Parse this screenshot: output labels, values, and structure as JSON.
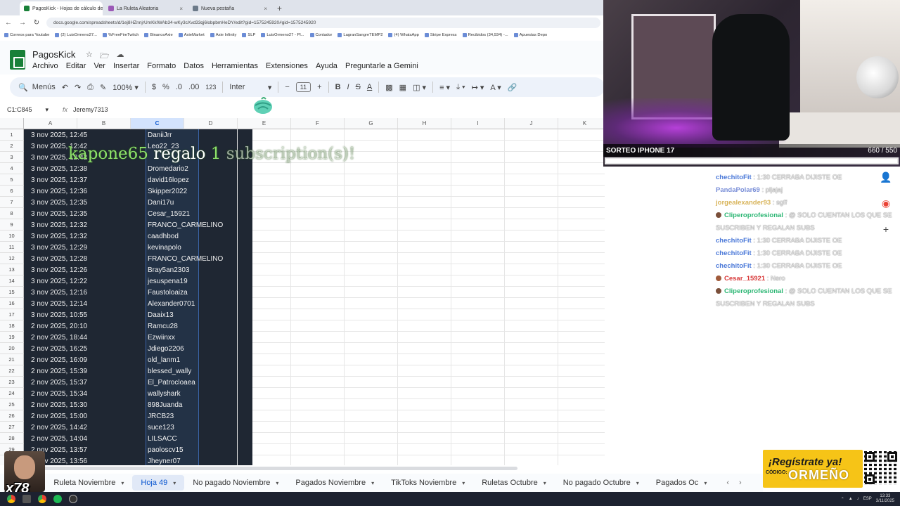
{
  "browser": {
    "tabs": [
      {
        "label": "PagosKick - Hojas de cálculo de",
        "active": true,
        "color": "#188038"
      },
      {
        "label": "La Ruleta Aleatoria",
        "active": false,
        "color": "#9b59b6"
      },
      {
        "label": "Nueva pestaña",
        "active": false,
        "color": "#6c7a89"
      }
    ],
    "new_tab": "+",
    "url": "docs.google.com/spreadsheets/d/1ej8HZnnjrUmKkIWAb34-wKy3cXvd33qj6lobpbmHeDY/edit?gid=1575245920#gid=1575245920",
    "bookmarks": [
      "Correos para Youtube",
      "(2) LuisOrmeno27...",
      "%FreeFireTwitch",
      "BinanceAxie",
      "AxieMarket",
      "Axie Infinity",
      "SLP",
      "LuisOrmeno27 - Pl...",
      "Contador",
      "LagranSangreTEMP2",
      "(4) WhatsApp",
      "Stripe Express",
      "Recibidos (34,934) -...",
      "Apuestas Depo"
    ]
  },
  "sheets": {
    "title": "PagosKick",
    "menu": [
      "Archivo",
      "Editar",
      "Ver",
      "Insertar",
      "Formato",
      "Datos",
      "Herramientas",
      "Extensiones",
      "Ayuda",
      "Preguntarle a Gemini"
    ],
    "toolbar": {
      "search": "Menús",
      "zoom": "100%",
      "currency": "$",
      "percent": "%",
      "dec_less": ".0",
      "dec_more": ".00",
      "num_format": "123",
      "font": "Inter",
      "font_size": "11",
      "bold": "B",
      "italic": "I",
      "strike": "S",
      "text_color": "A"
    },
    "name_box": "C1:C845",
    "formula_value": "Jeremy7313",
    "columns": [
      "A",
      "B",
      "C",
      "D",
      "E",
      "F",
      "G",
      "H",
      "I",
      "J",
      "K"
    ],
    "rows": [
      {
        "n": "1",
        "a": "3 nov 2025, 12:45",
        "c": "DaniiJrr"
      },
      {
        "n": "2",
        "a": "3 nov 2025, 12:42",
        "c": "Leo22_23"
      },
      {
        "n": "3",
        "a": "3 nov 2025, 12:42",
        "c": ""
      },
      {
        "n": "4",
        "a": "3 nov 2025, 12:38",
        "c": "Dromedario2"
      },
      {
        "n": "5",
        "a": "3 nov 2025, 12:37",
        "c": "david16lopez"
      },
      {
        "n": "6",
        "a": "3 nov 2025, 12:36",
        "c": "Skipper2022"
      },
      {
        "n": "7",
        "a": "3 nov 2025, 12:35",
        "c": "Dani17u"
      },
      {
        "n": "8",
        "a": "3 nov 2025, 12:35",
        "c": "Cesar_15921"
      },
      {
        "n": "9",
        "a": "3 nov 2025, 12:32",
        "c": "FRANCO_CARMELINO"
      },
      {
        "n": "10",
        "a": "3 nov 2025, 12:32",
        "c": "caadhbod"
      },
      {
        "n": "11",
        "a": "3 nov 2025, 12:29",
        "c": "kevinapolo"
      },
      {
        "n": "12",
        "a": "3 nov 2025, 12:28",
        "c": "FRANCO_CARMELINO"
      },
      {
        "n": "13",
        "a": "3 nov 2025, 12:26",
        "c": "Bray5an2303"
      },
      {
        "n": "14",
        "a": "3 nov 2025, 12:22",
        "c": "jesuspena19"
      },
      {
        "n": "15",
        "a": "3 nov 2025, 12:16",
        "c": "Faustoloaiza"
      },
      {
        "n": "16",
        "a": "3 nov 2025, 12:14",
        "c": "Alexander0701"
      },
      {
        "n": "17",
        "a": "3 nov 2025, 10:55",
        "c": "Daaix13"
      },
      {
        "n": "18",
        "a": "2 nov 2025, 20:10",
        "c": "Ramcu28"
      },
      {
        "n": "19",
        "a": "2 nov 2025, 18:44",
        "c": "Ezwiinxx"
      },
      {
        "n": "20",
        "a": "2 nov 2025, 16:25",
        "c": "Jdiego2206"
      },
      {
        "n": "21",
        "a": "2 nov 2025, 16:09",
        "c": "old_lanm1"
      },
      {
        "n": "22",
        "a": "2 nov 2025, 15:39",
        "c": "blessed_wally"
      },
      {
        "n": "23",
        "a": "2 nov 2025, 15:37",
        "c": "El_Patrocloaea"
      },
      {
        "n": "24",
        "a": "2 nov 2025, 15:34",
        "c": "wallyshark"
      },
      {
        "n": "25",
        "a": "2 nov 2025, 15:30",
        "c": "898Juanda"
      },
      {
        "n": "26",
        "a": "2 nov 2025, 15:00",
        "c": "JRCB23"
      },
      {
        "n": "27",
        "a": "2 nov 2025, 14:42",
        "c": "suce123"
      },
      {
        "n": "28",
        "a": "2 nov 2025, 14:04",
        "c": "LILSACC"
      },
      {
        "n": "29",
        "a": "2 nov 2025, 13:57",
        "c": "paoloscv15"
      },
      {
        "n": "30",
        "a": "2 nov 2025, 13:56",
        "c": "Jheyner07"
      }
    ],
    "sheet_tabs": [
      {
        "label": "Ruleta Noviembre",
        "active": false
      },
      {
        "label": "Hoja 49",
        "active": true
      },
      {
        "label": "No pagado Noviembre",
        "active": false
      },
      {
        "label": "Pagados Noviembre",
        "active": false
      },
      {
        "label": "TikToks Noviembre",
        "active": false
      },
      {
        "label": "Ruletas Octubre",
        "active": false
      },
      {
        "label": "No pagado Octubre",
        "active": false
      },
      {
        "label": "Pagados Oc",
        "active": false
      }
    ]
  },
  "overlay": {
    "gifter": "kapone65",
    "gift_word": "regalo",
    "gift_count": "1",
    "gift_suffix": "subscription(s)!"
  },
  "stream": {
    "caption": "SORTEO IPHONE 17",
    "counter": "660 / 550",
    "progress_fraction": 1.0
  },
  "chat": [
    {
      "user": "chechitoFit",
      "color": "#4a78d8",
      "badge": "",
      "msg": ": 1:30 CERRABA DIJISTE OE"
    },
    {
      "user": "PandaPolar69",
      "color": "#7a8fd8",
      "badge": "",
      "msg": ": pljajaj"
    },
    {
      "user": "jorgealexander93",
      "color": "#d8b45a",
      "badge": "",
      "msg": ": sgff"
    },
    {
      "user": "Cliperoprofesional",
      "color": "#2bb673",
      "badge": "#7a4f3a",
      "msg": ": @ SOLO CUENTAN LOS QUE SE SUSCRIBEN Y REGALAN SUBS"
    },
    {
      "user": "chechitoFit",
      "color": "#4a78d8",
      "badge": "",
      "msg": ": 1:30 CERRABA DIJISTE OE"
    },
    {
      "user": "chechitoFit",
      "color": "#4a78d8",
      "badge": "",
      "msg": ": 1:30 CERRABA DIJISTE OE"
    },
    {
      "user": "chechitoFit",
      "color": "#4a78d8",
      "badge": "",
      "msg": ": 1:30 CERRABA DIJISTE OE"
    },
    {
      "user": "Cesar_15921",
      "color": "#d83a3a",
      "badge": "#a05a3a",
      "msg": ": Nero"
    },
    {
      "user": "Cliperoprofesional",
      "color": "#2bb673",
      "badge": "#7a4f3a",
      "msg": ": @ SOLO CUENTAN LOS QUE SE SUSCRIBEN Y REGALAN SUBS"
    }
  ],
  "sponsor": {
    "headline": "¡Regístrate ya!",
    "code_label": "CÓDIGO:",
    "code": "ORMEÑO"
  },
  "emote": {
    "text": "x78"
  },
  "taskbar": {
    "lang": "ESP",
    "time": "13:33",
    "date": "3/11/2025"
  },
  "colors": {
    "dark_cells": "#1f2733",
    "selected_col": "#233246",
    "accent": "#0b57d0",
    "sheets_green": "#188038",
    "sponsor_yellow": "#f6c417",
    "overlay_green": "#8de06a"
  }
}
